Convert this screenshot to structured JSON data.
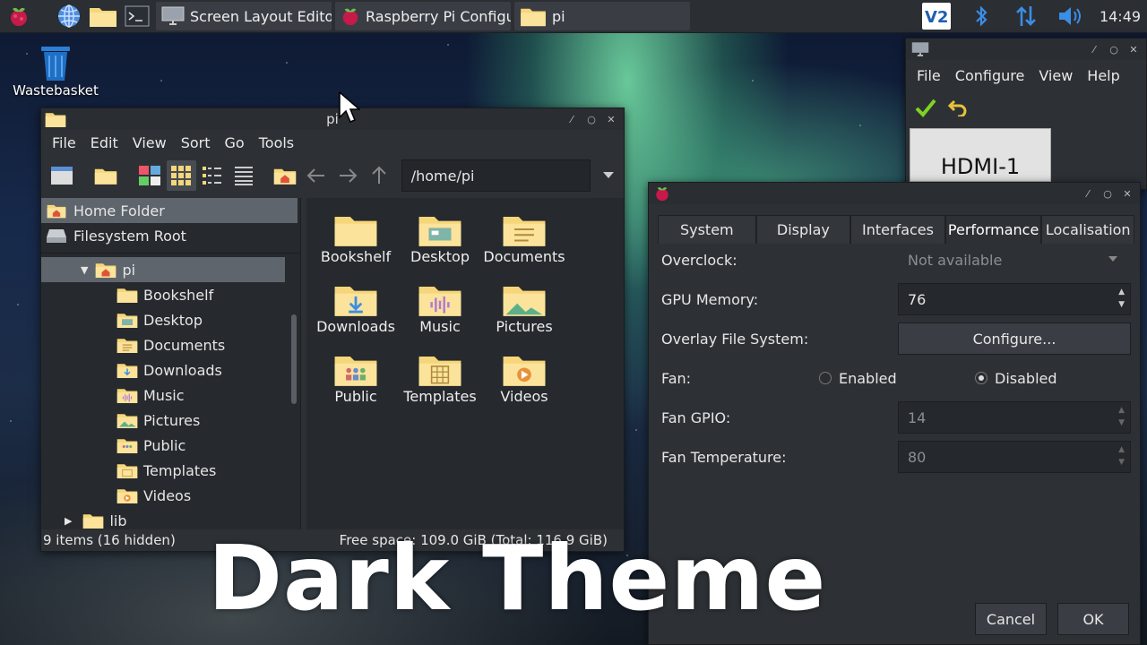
{
  "taskbar": {
    "tasks": [
      {
        "label": "Screen Layout Editor",
        "icon": "monitor-icon"
      },
      {
        "label": "Raspberry Pi Configu...",
        "icon": "raspberry-icon"
      },
      {
        "label": "pi",
        "icon": "folder-icon"
      }
    ],
    "clock": "14:49",
    "tray_icons": [
      "vnc-icon",
      "bluetooth-icon",
      "network-icon",
      "volume-icon"
    ]
  },
  "desktop": {
    "wastebasket_label": "Wastebasket"
  },
  "file_manager": {
    "title": "pi",
    "menu": [
      "File",
      "Edit",
      "View",
      "Sort",
      "Go",
      "Tools"
    ],
    "path": "/home/pi",
    "places": [
      "Home Folder",
      "Filesystem Root"
    ],
    "tree_root": "pi",
    "tree_children": [
      "Bookshelf",
      "Desktop",
      "Documents",
      "Downloads",
      "Music",
      "Pictures",
      "Public",
      "Templates",
      "Videos"
    ],
    "tree_next": "lib",
    "items": [
      "Bookshelf",
      "Desktop",
      "Documents",
      "Downloads",
      "Music",
      "Pictures",
      "Public",
      "Templates",
      "Videos"
    ],
    "status_left": "9 items (16 hidden)",
    "status_right": "Free space: 109.0 GiB (Total: 116.9 GiB)"
  },
  "screen_layout": {
    "menu": [
      "File",
      "Configure",
      "View",
      "Help"
    ],
    "display": "HDMI-1"
  },
  "config": {
    "tabs": [
      "System",
      "Display",
      "Interfaces",
      "Performance",
      "Localisation"
    ],
    "active_tab": "Performance",
    "overclock_label": "Overclock:",
    "overclock_value": "Not available",
    "gpu_label": "GPU Memory:",
    "gpu_value": "76",
    "overlay_label": "Overlay File System:",
    "overlay_button": "Configure...",
    "fan_label": "Fan:",
    "fan_enabled": "Enabled",
    "fan_disabled": "Disabled",
    "fan_gpio_label": "Fan GPIO:",
    "fan_gpio_value": "14",
    "fan_temp_label": "Fan Temperature:",
    "fan_temp_value": "80",
    "cancel": "Cancel",
    "ok": "OK"
  },
  "caption": "Dark Theme",
  "colors": {
    "folder": "#f6d67a",
    "selection": "#5f656c",
    "window_bg": "#2d3135"
  }
}
